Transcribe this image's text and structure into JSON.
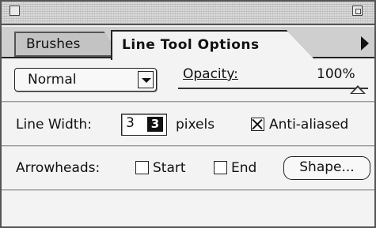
{
  "window": {
    "title": ""
  },
  "tabs": [
    {
      "label": "Brushes",
      "active": false
    },
    {
      "label": "Line Tool Options",
      "active": true
    }
  ],
  "options": {
    "blend_mode": {
      "value": "Normal"
    },
    "opacity": {
      "label": "Opacity:",
      "value": "100%",
      "level": 1.0
    },
    "line_width": {
      "label": "Line Width:",
      "value": "3",
      "unit_label": "pixels"
    },
    "anti_aliased": {
      "label": "Anti-aliased",
      "checked": true
    },
    "arrowheads": {
      "label": "Arrowheads:",
      "start": {
        "label": "Start",
        "checked": false
      },
      "end": {
        "label": "End",
        "checked": false
      },
      "shape_button": "Shape..."
    }
  },
  "icons": [
    "close-box-icon",
    "zoom-box-icon",
    "palette-menu-arrow-icon",
    "dropdown-arrow-icon"
  ],
  "colors": {
    "panel_bg": "#f3f3f3",
    "tab_inactive": "#c3c3c3",
    "frame": "#555555"
  }
}
